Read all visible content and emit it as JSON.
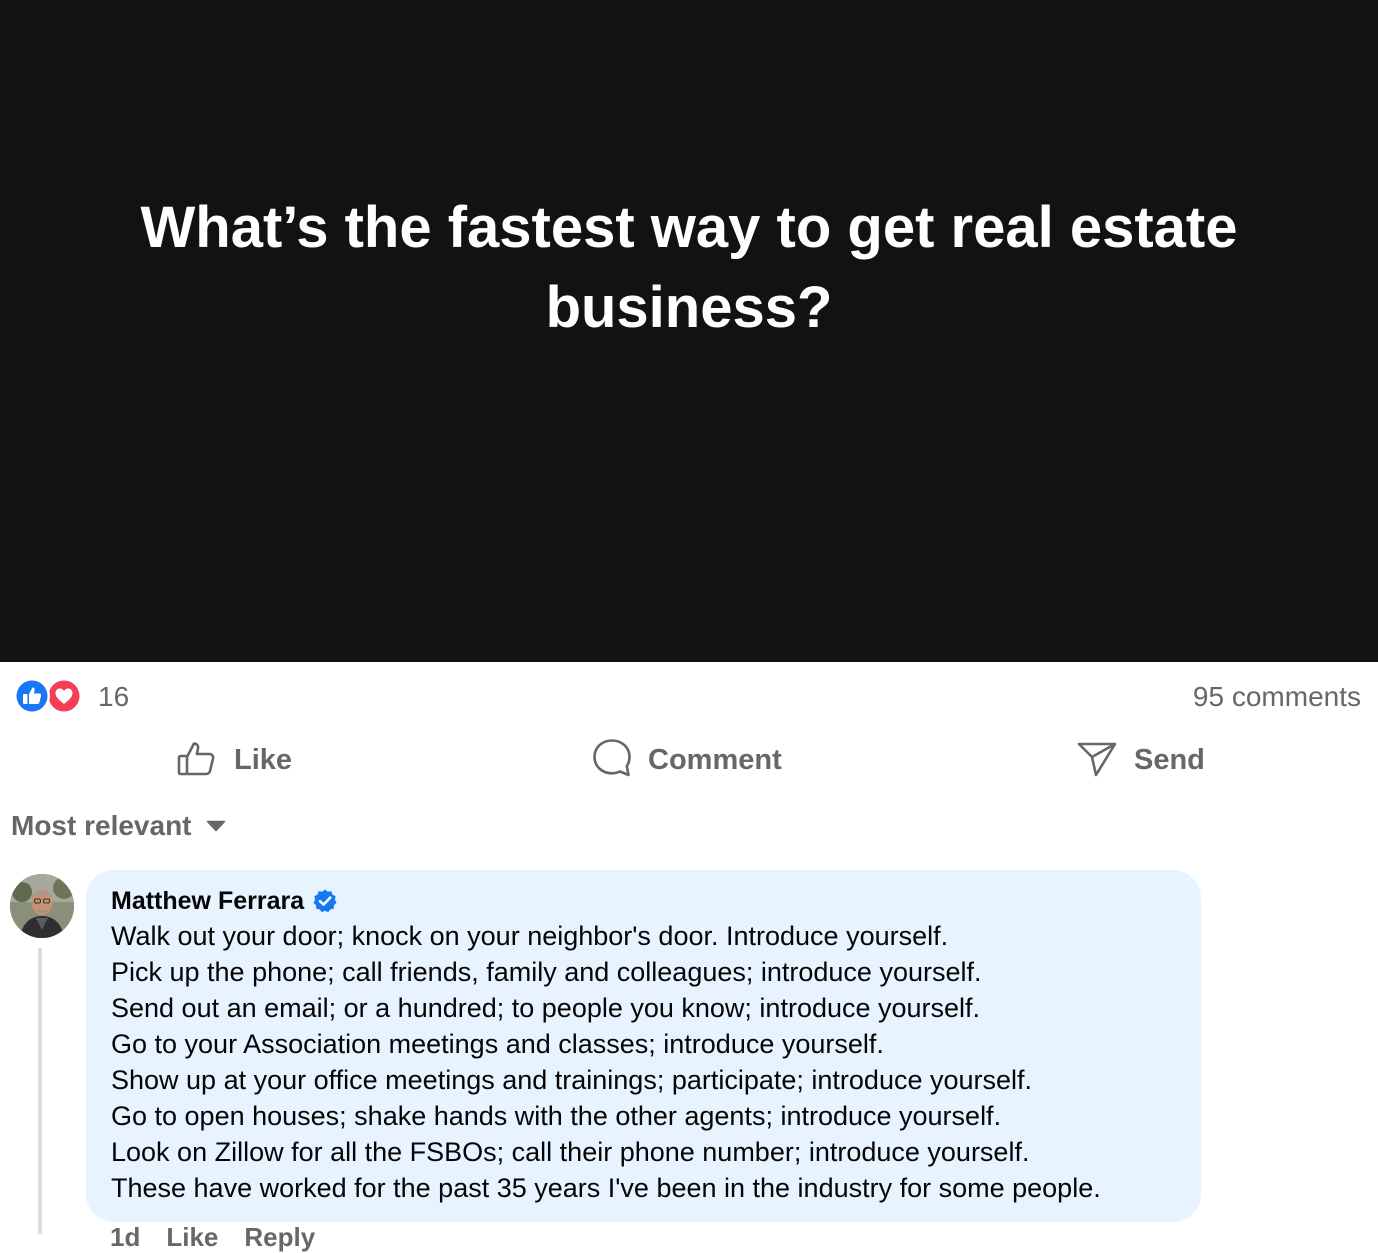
{
  "post": {
    "question_lines": [
      "What’s the fastest way to get real estate",
      "business?"
    ],
    "colors": {
      "hero_background": "#121212",
      "like_blue": "#1877f2",
      "heart_red": "#f33e58",
      "muted_text": "#65676b",
      "comment_bubble": "#e7f3ff"
    }
  },
  "stats": {
    "reaction_count": "16",
    "comments_count": "95 comments",
    "reaction_icons": [
      "like-icon",
      "love-icon"
    ]
  },
  "actions": {
    "like_label": "Like",
    "comment_label": "Comment",
    "send_label": "Send"
  },
  "sort": {
    "label": "Most relevant",
    "icon": "caret-down-icon"
  },
  "comment": {
    "author": "Matthew Ferrara",
    "verified": true,
    "lines": [
      "Walk out your door; knock on your neighbor's door. Introduce yourself.",
      "Pick up the phone; call friends, family and colleagues; introduce yourself.",
      "Send out an email; or a hundred; to people you know; introduce yourself.",
      "Go to your Association meetings and classes; introduce yourself.",
      "Show up at your office meetings and trainings; participate; introduce yourself.",
      "Go to open houses; shake hands with the other agents; introduce yourself.",
      "Look on Zillow for all the FSBOs; call their phone number; introduce yourself.",
      "These have worked for the past 35 years I've been in the industry for some people."
    ],
    "meta": {
      "time": "1d",
      "like_label": "Like",
      "reply_label": "Reply"
    }
  }
}
